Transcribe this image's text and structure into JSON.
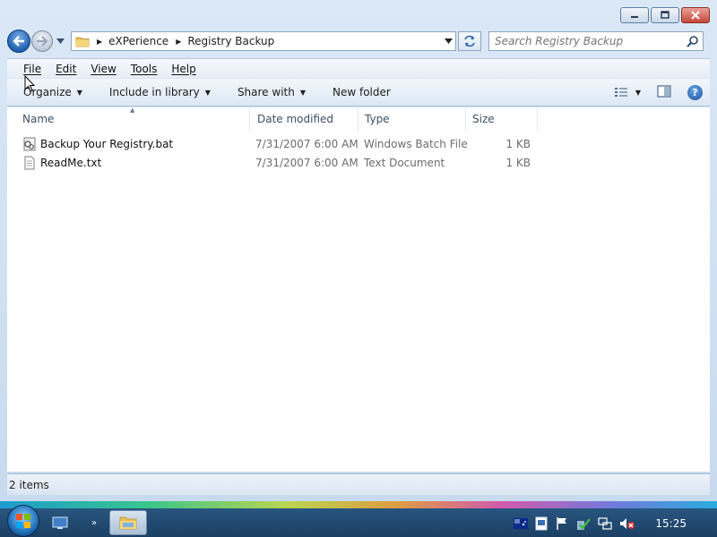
{
  "window": {
    "caption_buttons": [
      "minimize",
      "maximize",
      "close"
    ]
  },
  "address": {
    "crumbs": [
      "eXPerience",
      "Registry Backup"
    ]
  },
  "search": {
    "placeholder": "Search Registry Backup"
  },
  "menu": {
    "items": [
      "File",
      "Edit",
      "View",
      "Tools",
      "Help"
    ]
  },
  "commands": {
    "organize": "Organize",
    "include_in_library": "Include in library",
    "share_with": "Share with",
    "new_folder": "New folder"
  },
  "columns": {
    "name": "Name",
    "date_modified": "Date modified",
    "type": "Type",
    "size": "Size"
  },
  "files": [
    {
      "name": "Backup Your Registry.bat",
      "date": "7/31/2007 6:00 AM",
      "type": "Windows Batch File",
      "size": "1 KB",
      "icon": "batch-file-icon"
    },
    {
      "name": "ReadMe.txt",
      "date": "7/31/2007 6:00 AM",
      "type": "Text Document",
      "size": "1 KB",
      "icon": "text-file-icon"
    }
  ],
  "status": {
    "item_count": "2 items"
  },
  "taskbar": {
    "clock": "15:25"
  }
}
